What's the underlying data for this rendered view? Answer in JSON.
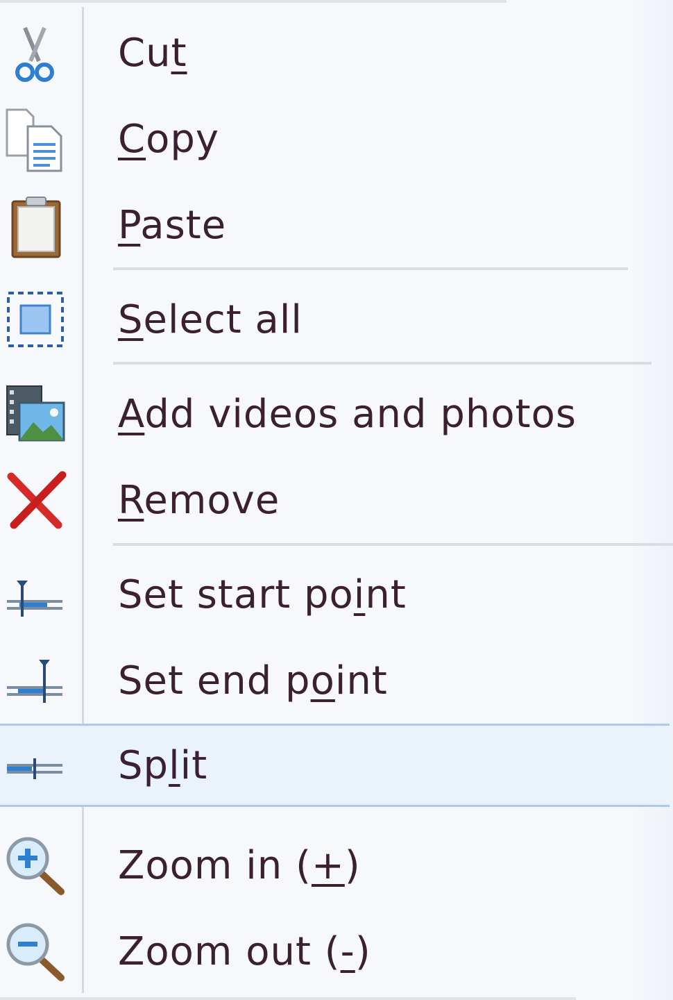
{
  "menu": {
    "items": [
      {
        "id": "cut",
        "pre": "Cu",
        "key": "t",
        "post": "",
        "icon": "scissors-icon"
      },
      {
        "id": "copy",
        "pre": "",
        "key": "C",
        "post": "opy",
        "icon": "copy-icon"
      },
      {
        "id": "paste",
        "pre": "",
        "key": "P",
        "post": "aste",
        "icon": "clipboard-icon"
      },
      {
        "id": "select-all",
        "pre": "",
        "key": "S",
        "post": "elect all",
        "icon": "select-all-icon"
      },
      {
        "id": "add-videos-and-photos",
        "pre": "",
        "key": "A",
        "post": "dd videos and photos",
        "icon": "film-photo-icon"
      },
      {
        "id": "remove",
        "pre": "",
        "key": "R",
        "post": "emove",
        "icon": "red-x-icon"
      },
      {
        "id": "set-start-point",
        "pre": "Set start po",
        "key": "i",
        "post": "nt",
        "icon": "set-start-point-icon"
      },
      {
        "id": "set-end-point",
        "pre": "Set end p",
        "key": "o",
        "post": "int",
        "icon": "set-end-point-icon"
      },
      {
        "id": "split",
        "pre": "Sp",
        "key": "l",
        "post": "it",
        "icon": "split-icon",
        "highlighted": true
      },
      {
        "id": "zoom-in",
        "pre": "Zoom in (",
        "key": "+",
        "post": ")",
        "icon": "zoom-in-icon"
      },
      {
        "id": "zoom-out",
        "pre": "Zoom out (",
        "key": "-",
        "post": ")",
        "icon": "zoom-out-icon"
      }
    ]
  },
  "colors": {
    "background": "#f6f8fb",
    "text": "#3a2030",
    "highlight": "#eaf2fc",
    "highlight_border": "#a9c9ee",
    "separator": "#d9dce1"
  }
}
